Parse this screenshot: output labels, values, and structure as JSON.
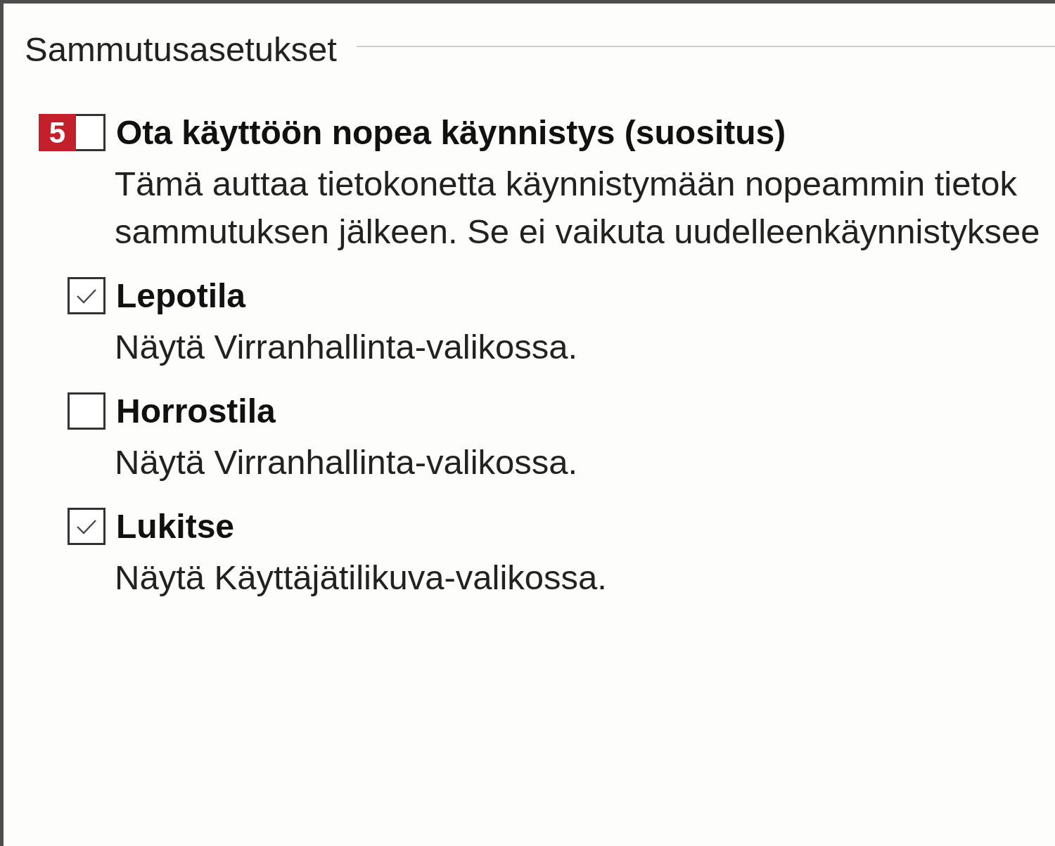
{
  "group": {
    "title": "Sammutusasetukset"
  },
  "options": [
    {
      "label": "Ota käyttöön nopea käynnistys (suositus)",
      "checked": false,
      "badge": "5",
      "description": [
        "Tämä auttaa tietokonetta käynnistymään nopeammin tietok",
        "sammutuksen jälkeen. Se ei vaikuta uudelleenkäynnistyksee"
      ]
    },
    {
      "label": "Lepotila",
      "checked": true,
      "description": [
        "Näytä Virranhallinta-valikossa."
      ]
    },
    {
      "label": "Horrostila",
      "checked": false,
      "description": [
        "Näytä Virranhallinta-valikossa."
      ]
    },
    {
      "label": "Lukitse",
      "checked": true,
      "description": [
        "Näytä Käyttäjätilikuva-valikossa."
      ]
    }
  ]
}
